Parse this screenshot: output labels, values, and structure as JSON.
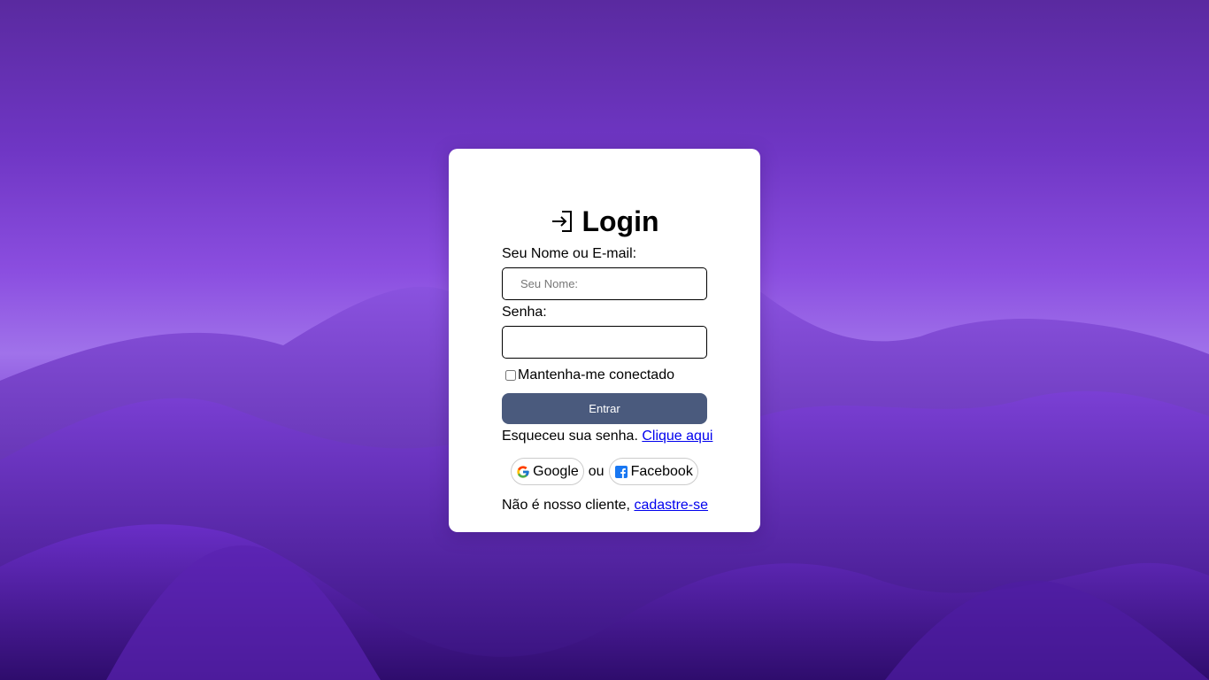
{
  "login": {
    "title": "Login",
    "name_label": "Seu Nome ou E-mail:",
    "name_placeholder": "Seu Nome:",
    "name_value": "",
    "password_label": "Senha:",
    "password_value": "",
    "remember_label": "Mantenha-me conectado",
    "remember_checked": false,
    "submit_label": "Entrar",
    "forgot_text": "Esqueceu sua senha.",
    "forgot_link": "Clique aqui",
    "google_label": "Google",
    "or_text": "ou",
    "facebook_label": "Facebook",
    "signup_text": "Não é nosso cliente,",
    "signup_link": "cadastre-se"
  },
  "icons": {
    "title_icon": "login-enter-icon",
    "google_icon": "google-icon",
    "facebook_icon": "facebook-icon"
  },
  "colors": {
    "background": "#6f36c4",
    "card": "#ffffff",
    "submit_button": "#4a5a7d",
    "link": "#0000ee",
    "facebook": "#1877f2"
  }
}
